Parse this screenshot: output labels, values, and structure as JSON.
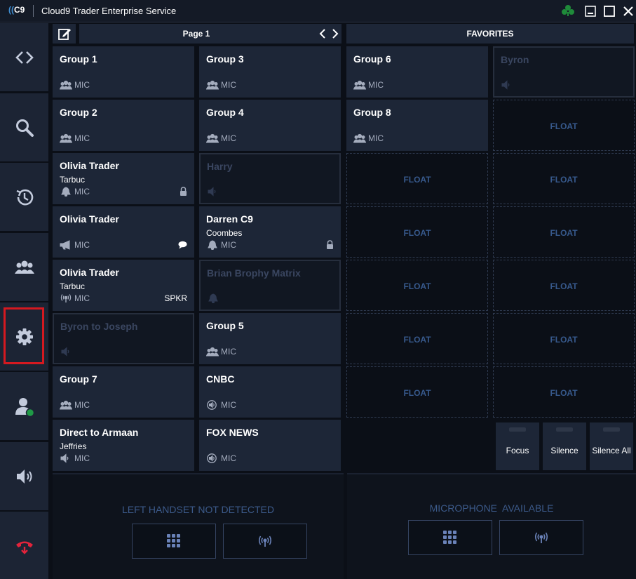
{
  "window": {
    "logo_text": "C9",
    "title": "Cloud9 Trader Enterprise Service"
  },
  "sidebar": {
    "items": [
      {
        "name": "code-icon"
      },
      {
        "name": "search-icon"
      },
      {
        "name": "history-icon"
      },
      {
        "name": "groups-icon"
      },
      {
        "name": "gear-icon"
      },
      {
        "name": "user-status-icon"
      },
      {
        "name": "speaker-icon"
      },
      {
        "name": "hangup-icon"
      }
    ],
    "selected": "gear-icon"
  },
  "toolbar": {
    "page_label": "Page 1",
    "favorites_label": "FAVORITES"
  },
  "tiles": [
    {
      "name": "Group 1",
      "sub": "",
      "icon": "group-icon",
      "mic": "MIC",
      "state": "active"
    },
    {
      "name": "Group 3",
      "sub": "",
      "icon": "group-icon",
      "mic": "MIC",
      "state": "active"
    },
    {
      "name": "Group 2",
      "sub": "",
      "icon": "group-icon",
      "mic": "MIC",
      "state": "active"
    },
    {
      "name": "Group 4",
      "sub": "",
      "icon": "group-icon",
      "mic": "MIC",
      "state": "active"
    },
    {
      "name": "Olivia Trader",
      "sub": "Tarbuc",
      "icon": "bell-icon",
      "mic": "MIC",
      "state": "active",
      "extra": "lock-icon"
    },
    {
      "name": "Harry",
      "sub": "",
      "icon": "speaker-icon",
      "mic": "",
      "state": "inactive"
    },
    {
      "name": "Olivia Trader",
      "sub": "",
      "icon": "megaphone-icon",
      "mic": "MIC",
      "state": "active",
      "extra": "chat-icon"
    },
    {
      "name": "Darren C9",
      "sub": "Coombes",
      "icon": "bell-icon",
      "mic": "MIC",
      "state": "active",
      "extra": "lock-icon"
    },
    {
      "name": "Olivia Trader",
      "sub": "Tarbuc",
      "icon": "radio-icon",
      "mic": "MIC",
      "state": "active",
      "right_text": "SPKR"
    },
    {
      "name": "Brian Brophy Matrix",
      "sub": "",
      "icon": "bell-icon",
      "mic": "",
      "state": "inactive"
    },
    {
      "name": "Byron to Joseph",
      "sub": "",
      "icon": "speaker-icon",
      "mic": "",
      "state": "inactive"
    },
    {
      "name": "Group 5",
      "sub": "",
      "icon": "group-icon",
      "mic": "MIC",
      "state": "active"
    },
    {
      "name": "Group 7",
      "sub": "",
      "icon": "group-icon",
      "mic": "MIC",
      "state": "active"
    },
    {
      "name": "CNBC",
      "sub": "",
      "icon": "volume-circle-icon",
      "mic": "MIC",
      "state": "active"
    },
    {
      "name": "Direct to Armaan",
      "sub": "Jeffries",
      "icon": "speaker-icon",
      "mic": "MIC",
      "state": "active"
    },
    {
      "name": "FOX NEWS",
      "sub": "",
      "icon": "volume-circle-icon",
      "mic": "MIC",
      "state": "active"
    }
  ],
  "favorites": [
    {
      "name": "Group 6",
      "icon": "group-icon",
      "mic": "MIC",
      "state": "active"
    },
    {
      "name": "Byron",
      "icon": "speaker-icon",
      "mic": "",
      "state": "inactive"
    },
    {
      "name": "Group 8",
      "icon": "group-icon",
      "mic": "MIC",
      "state": "active"
    }
  ],
  "float_label": "FLOAT",
  "quick_buttons": {
    "focus": "Focus",
    "silence": "Silence",
    "silence_all": "Silence All"
  },
  "handsets": {
    "left_status": "LEFT HANDSET NOT DETECTED",
    "right_status": "MICROPHONE  AVAILABLE"
  },
  "colors": {
    "accent_blue": "#3f8fd4",
    "hangup_red": "#e3233b",
    "status_green": "#1f9a46",
    "selection_red": "#d51920"
  }
}
